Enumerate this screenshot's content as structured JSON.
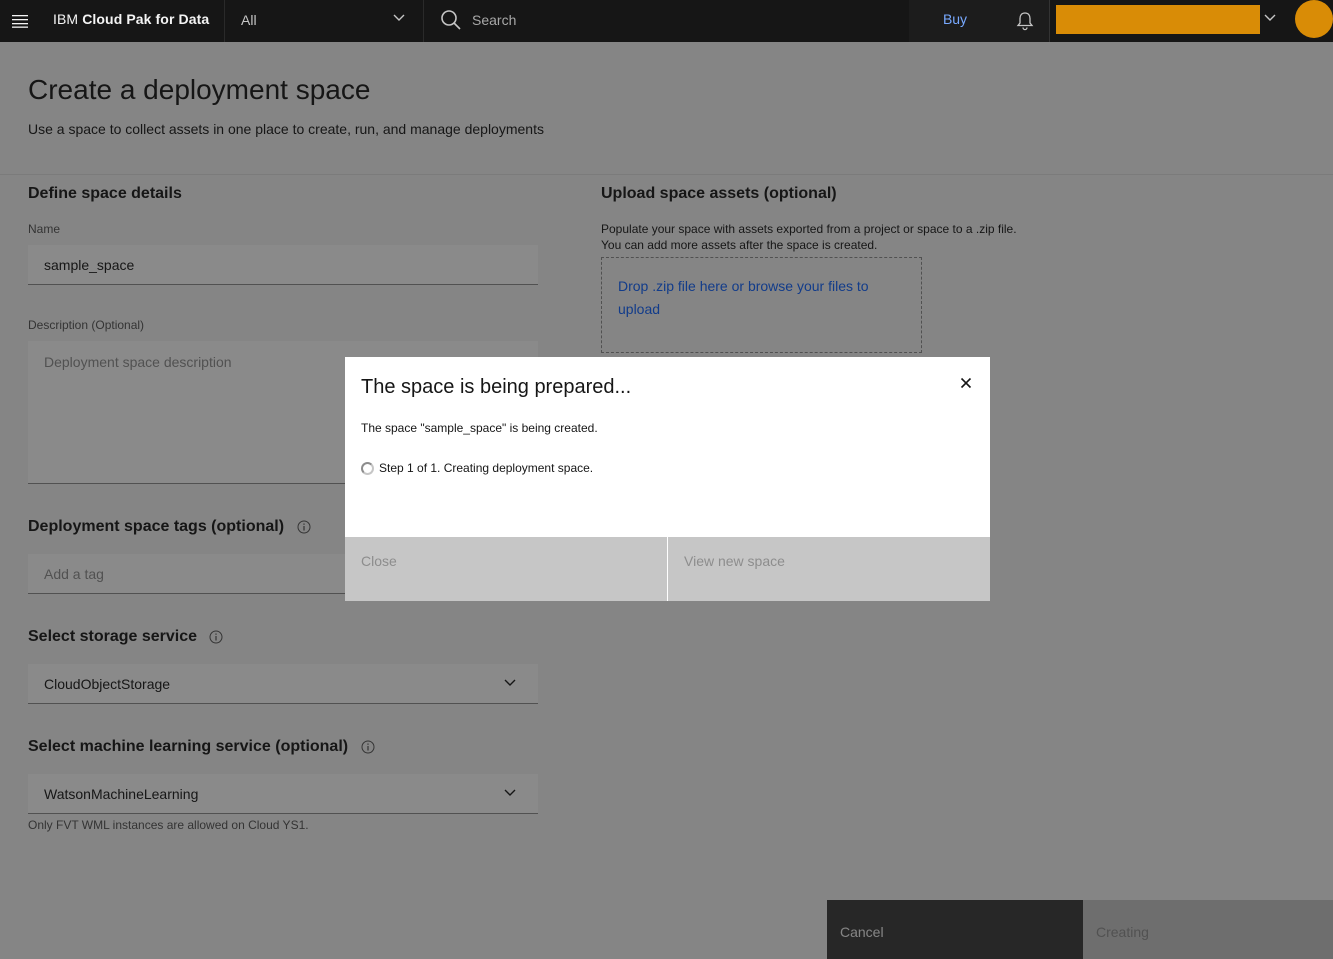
{
  "header": {
    "brand_prefix": "IBM",
    "brand_name": "Cloud Pak for Data",
    "scope_value": "All",
    "search_placeholder": "Search",
    "buy_label": "Buy",
    "account_color": "#d98c06"
  },
  "page": {
    "title": "Create a deployment space",
    "subtitle": "Use a space to collect assets in one place to create, run, and manage deployments"
  },
  "details": {
    "heading": "Define space details",
    "name_label": "Name",
    "name_value": "sample_space",
    "description_label": "Description (Optional)",
    "description_placeholder": "Deployment space description",
    "tags_heading": "Deployment space tags (optional)",
    "tags_placeholder": "Add a tag",
    "storage_heading": "Select storage service",
    "storage_value": "CloudObjectStorage",
    "ml_heading": "Select machine learning service (optional)",
    "ml_value": "WatsonMachineLearning",
    "ml_helper": "Only FVT WML instances are allowed on Cloud YS1."
  },
  "upload": {
    "heading": "Upload space assets (optional)",
    "desc_line1": "Populate your space with assets exported from a project or space to a .zip file.",
    "desc_line2": "You can add more assets after the space is created.",
    "dropzone_text": "Drop .zip file here or browse your files to upload"
  },
  "footer": {
    "cancel_label": "Cancel",
    "create_label": "Creating"
  },
  "modal": {
    "title": "The space is being prepared...",
    "body": "The space \"sample_space\" is being created.",
    "step": "Step 1 of 1. Creating deployment space.",
    "close_label": "Close",
    "view_label": "View new space"
  },
  "icons": {
    "menu": "hamburger-icon",
    "search": "search-icon",
    "bell": "notification-bell-icon",
    "chevron": "chevron-down-icon",
    "info": "info-icon",
    "close": "close-icon",
    "spinner": "loading-spinner-icon"
  }
}
